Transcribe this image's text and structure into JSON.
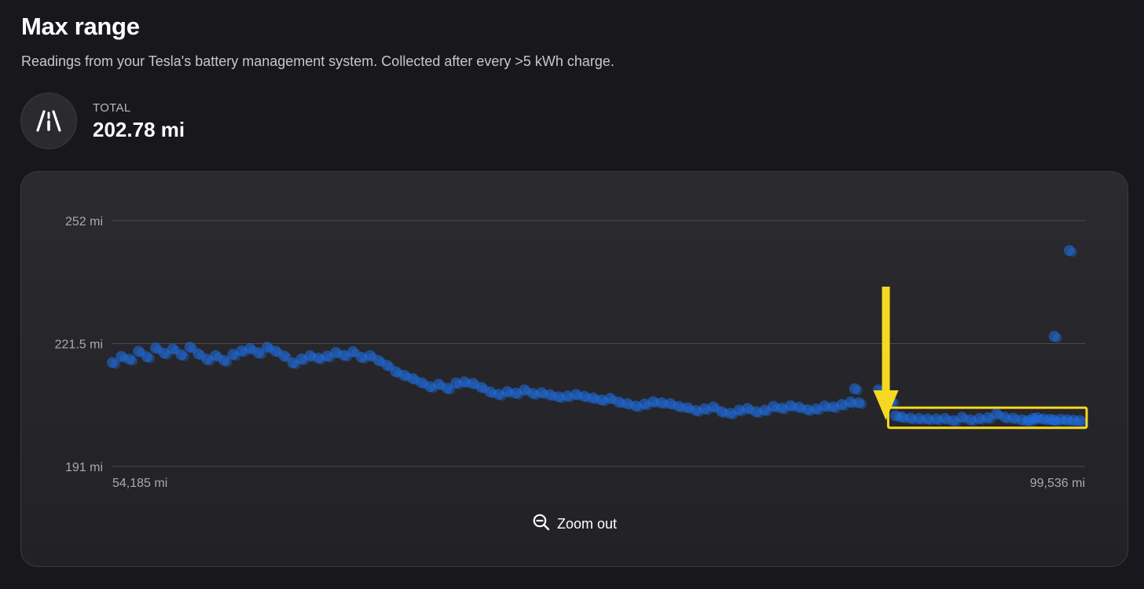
{
  "page": {
    "title": "Max range",
    "subtitle": "Readings from your Tesla's battery management system. Collected after every >5 kWh charge."
  },
  "stat": {
    "icon": "road-icon",
    "label": "TOTAL",
    "value": "202.78 mi"
  },
  "zoom": {
    "icon": "zoom-out-icon",
    "label": "Zoom out"
  },
  "colors": {
    "point": "#1f6fe5",
    "highlight": "#f5d820",
    "grid": "#4a4a50"
  },
  "chart_data": {
    "type": "scatter",
    "ylim": [
      191,
      252
    ],
    "xlim": [
      54185,
      99536
    ],
    "y_ticks": [
      "252 mi",
      "221.5 mi",
      "191 mi"
    ],
    "y_tick_values": [
      252,
      221.5,
      191
    ],
    "x_ticks": [
      "54,185 mi",
      "99,536 mi"
    ],
    "x_tick_values": [
      54185,
      99536
    ],
    "grid": true,
    "series": [
      {
        "points": [
          [
            54185,
            216.8
          ],
          [
            54600,
            218.3
          ],
          [
            55000,
            217.6
          ],
          [
            55400,
            219.6
          ],
          [
            55800,
            218.2
          ],
          [
            56200,
            220.4
          ],
          [
            56600,
            219.1
          ],
          [
            57000,
            220.2
          ],
          [
            57400,
            218.7
          ],
          [
            57800,
            220.6
          ],
          [
            58200,
            218.9
          ],
          [
            58600,
            217.6
          ],
          [
            59000,
            218.5
          ],
          [
            59400,
            217.3
          ],
          [
            59800,
            218.8
          ],
          [
            60200,
            219.7
          ],
          [
            60600,
            220.3
          ],
          [
            61000,
            219.2
          ],
          [
            61400,
            220.6
          ],
          [
            61800,
            219.6
          ],
          [
            62200,
            218.4
          ],
          [
            62600,
            216.7
          ],
          [
            63000,
            217.7
          ],
          [
            63400,
            218.5
          ],
          [
            63800,
            217.9
          ],
          [
            64200,
            218.4
          ],
          [
            64600,
            219.3
          ],
          [
            65000,
            218.6
          ],
          [
            65400,
            219.5
          ],
          [
            65800,
            218.1
          ],
          [
            66200,
            218.5
          ],
          [
            66600,
            217.3
          ],
          [
            67000,
            216.1
          ],
          [
            67400,
            214.5
          ],
          [
            67800,
            213.6
          ],
          [
            68200,
            212.8
          ],
          [
            68600,
            211.8
          ],
          [
            69000,
            210.8
          ],
          [
            69400,
            211.4
          ],
          [
            69800,
            210.4
          ],
          [
            70200,
            211.7
          ],
          [
            70600,
            212.0
          ],
          [
            71000,
            211.6
          ],
          [
            71400,
            210.6
          ],
          [
            71800,
            209.5
          ],
          [
            72200,
            208.9
          ],
          [
            72600,
            209.6
          ],
          [
            73000,
            209.2
          ],
          [
            73400,
            210.0
          ],
          [
            73800,
            209.1
          ],
          [
            74200,
            209.3
          ],
          [
            74600,
            208.8
          ],
          [
            75000,
            208.3
          ],
          [
            75400,
            208.5
          ],
          [
            75800,
            208.9
          ],
          [
            76200,
            208.4
          ],
          [
            76600,
            208.0
          ],
          [
            77000,
            207.5
          ],
          [
            77400,
            207.9
          ],
          [
            77800,
            207.0
          ],
          [
            78200,
            206.6
          ],
          [
            78600,
            206.0
          ],
          [
            79000,
            206.5
          ],
          [
            79400,
            207.1
          ],
          [
            79800,
            206.8
          ],
          [
            80200,
            206.6
          ],
          [
            80600,
            205.9
          ],
          [
            81000,
            205.6
          ],
          [
            81400,
            204.9
          ],
          [
            81800,
            205.3
          ],
          [
            82200,
            205.8
          ],
          [
            82600,
            204.6
          ],
          [
            83000,
            204.2
          ],
          [
            83400,
            205.0
          ],
          [
            83800,
            205.4
          ],
          [
            84200,
            204.6
          ],
          [
            84600,
            205.0
          ],
          [
            85000,
            205.9
          ],
          [
            85400,
            205.5
          ],
          [
            85800,
            206.1
          ],
          [
            86200,
            205.7
          ],
          [
            86600,
            205.1
          ],
          [
            87000,
            205.3
          ],
          [
            87400,
            206.0
          ],
          [
            87800,
            205.8
          ],
          [
            88200,
            206.4
          ],
          [
            88600,
            207.0
          ],
          [
            88800,
            210.3
          ],
          [
            89000,
            206.8
          ],
          [
            89900,
            210.0
          ],
          [
            90200,
            207.9
          ],
          [
            90500,
            207.1
          ],
          [
            90700,
            203.6
          ],
          [
            91000,
            203.3
          ],
          [
            91400,
            203.0
          ],
          [
            91800,
            202.9
          ],
          [
            92200,
            202.8
          ],
          [
            92600,
            202.8
          ],
          [
            93000,
            202.9
          ],
          [
            93400,
            202.4
          ],
          [
            93800,
            203.2
          ],
          [
            94200,
            202.6
          ],
          [
            94600,
            202.9
          ],
          [
            95000,
            203.1
          ],
          [
            95400,
            204.1
          ],
          [
            95800,
            203.2
          ],
          [
            96200,
            203.0
          ],
          [
            96600,
            202.6
          ],
          [
            96900,
            202.4
          ],
          [
            97100,
            202.9
          ],
          [
            97300,
            203.1
          ],
          [
            97600,
            202.8
          ],
          [
            97900,
            202.7
          ],
          [
            98100,
            202.5
          ],
          [
            98400,
            202.7
          ],
          [
            98700,
            202.6
          ],
          [
            99000,
            202.5
          ],
          [
            99300,
            202.4
          ],
          [
            98100,
            223.3
          ],
          [
            98800,
            244.6
          ]
        ]
      }
    ]
  }
}
